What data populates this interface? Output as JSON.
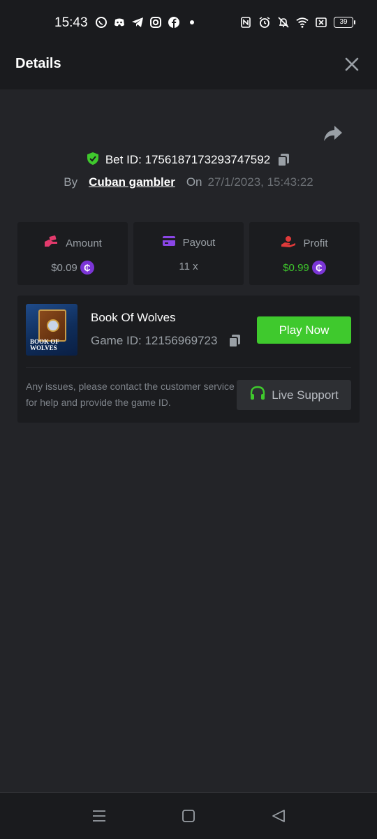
{
  "status_bar": {
    "time": "15:43",
    "left_icons": [
      "whatsapp-icon",
      "discord-icon",
      "telegram-icon",
      "instagram-icon",
      "facebook-icon",
      "dot-icon"
    ],
    "right_icons": [
      "nfc-icon",
      "alarm-icon",
      "mute-icon",
      "wifi-icon",
      "data-off-icon"
    ],
    "battery": "39"
  },
  "header": {
    "title": "Details"
  },
  "bet": {
    "id_text": "Bet ID: 1756187173293747592",
    "by_label": "By",
    "user": "Cuban gambler",
    "on_label": "On",
    "date": "27/1/2023, 15:43:22"
  },
  "stats": [
    {
      "label": "Amount",
      "value": "$0.09",
      "icon": "amount-icon"
    },
    {
      "label": "Payout",
      "value": "11 x",
      "icon": "payout-icon"
    },
    {
      "label": "Profit",
      "value": "$0.99",
      "icon": "profit-icon"
    }
  ],
  "game": {
    "thumb_title": "BOOK OF WOLVES",
    "name": "Book Of Wolves",
    "id_text": "Game ID: 12156969723",
    "play_label": "Play Now",
    "support_text": "Any issues, please contact the customer service for help and provide the game ID.",
    "support_label": "Live Support"
  },
  "colors": {
    "accent_green": "#3fc92d",
    "coin_purple": "#7b35d6",
    "amount_pink": "#e23a6c",
    "payout_purple": "#8a46e6",
    "profit_red": "#e03a3a"
  }
}
